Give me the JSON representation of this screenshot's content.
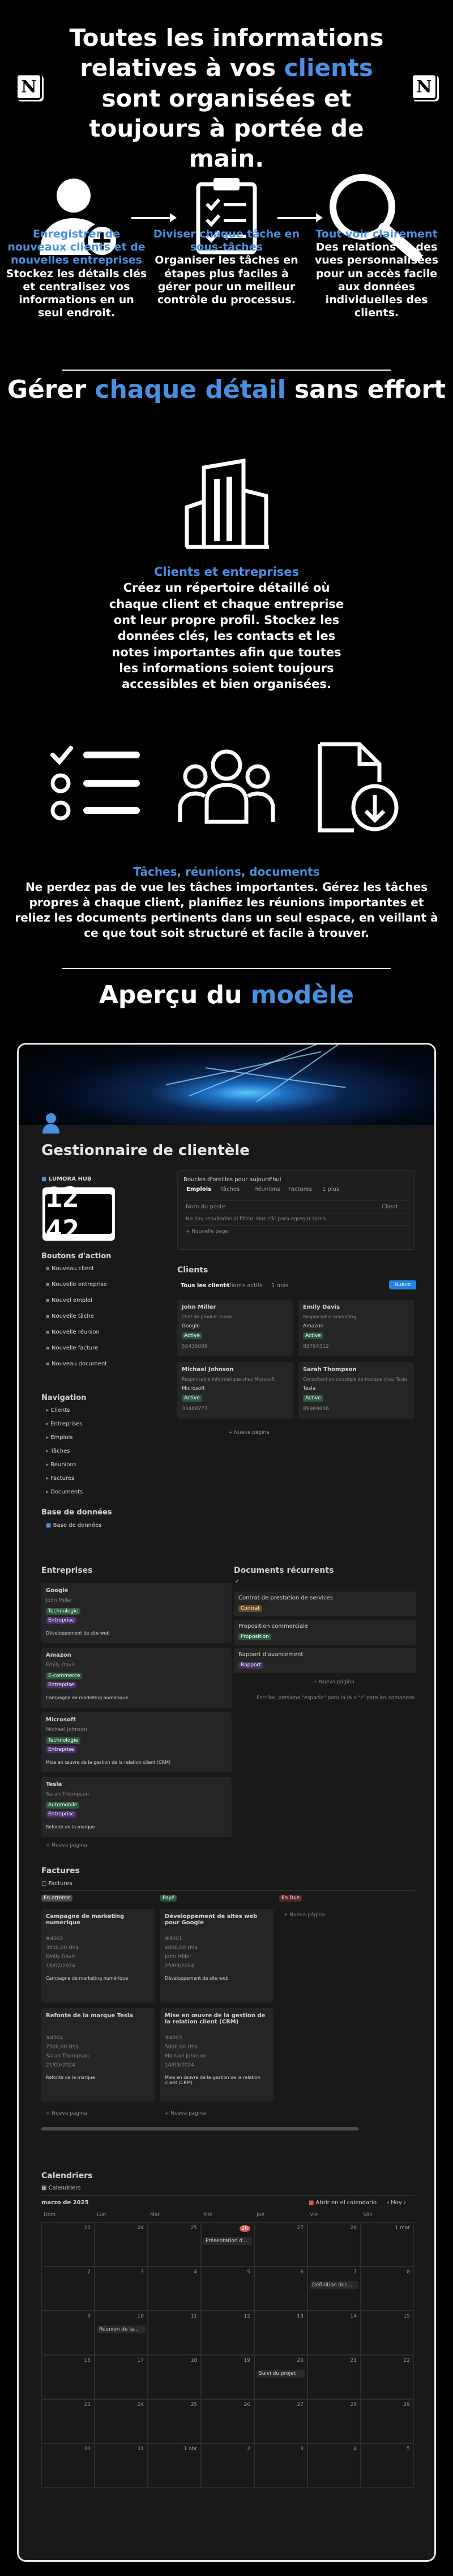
{
  "hero": {
    "title_part1": "Toutes les informations relatives à vos ",
    "title_highlight": "clients",
    "title_part2": " sont organisées et toujours à portée de main.",
    "logo_letter": "N"
  },
  "features": [
    {
      "title": "Enregistrer de nouveaux clients et de nouvelles entreprises",
      "desc": "Stockez les détails clés et centralisez vos informations en un seul endroit.",
      "icon": "add-user-icon"
    },
    {
      "title": "Diviser chaque tâche en sous-tâches",
      "desc": "Organiser les tâches en étapes plus faciles à gérer pour un meilleur contrôle du processus.",
      "icon": "checklist-icon"
    },
    {
      "title": "Tout voir clairement",
      "desc": "Des relations et des vues personnalisées pour un accès facile aux données individuelles des clients.",
      "icon": "search-icon"
    }
  ],
  "section1": {
    "prefix": "Gérer ",
    "highlight": "chaque détail",
    "suffix": " sans effort"
  },
  "clients_block": {
    "title": "Clients et entreprises",
    "desc": "Créez un répertoire détaillé où chaque client et chaque entreprise ont leur propre profil. Stockez les données clés, les contacts et les notes importantes afin que toutes les informations soient toujours accessibles et bien organisées."
  },
  "tasks_block": {
    "title": "Tâches, réunions, documents",
    "desc": "Ne perdez pas de vue les tâches importantes. Gérez les tâches propres à chaque client, planifiez les réunions importantes et reliez les documents pertinents dans un seul espace, en veillant à ce que tout soit structuré et facile à trouver."
  },
  "section2": {
    "prefix": "Aperçu du ",
    "highlight": "modèle"
  },
  "app": {
    "page_title": "Gestionnaire de clientèle",
    "hub": {
      "label": "LUMORA HUB",
      "clock": "12 42",
      "actions_title": "Boutons d'action",
      "actions": [
        "Nouveau client",
        "Nouvelle entreprise",
        "Nouvel emploi",
        "Nouvelle tâche",
        "Nouvelle réunion",
        "Nouvelle facture",
        "Nouveau document"
      ],
      "nav_title": "Navigation",
      "nav": [
        "Clients",
        "Entreprises",
        "Emplois",
        "Tâches",
        "Réunions",
        "Factures",
        "Documents"
      ],
      "db_title": "Base de données",
      "db_item": "Base de données"
    },
    "today": {
      "title": "Boucles d'oreilles pour aujourd'hui",
      "tabs": [
        "Emplois",
        "Tâches",
        "Réunions",
        "Factures",
        "1 plus"
      ],
      "cols": [
        "Nom du poste",
        "Client"
      ],
      "empty": "No hay resultados al filtrar. Haz clic para agregar tarea",
      "new": "+ Nouvelle page"
    },
    "clients": {
      "title": "Clients",
      "tabs": [
        "Tous les clients",
        "Clients actifs",
        "1 más"
      ],
      "new_button": "Nuevo",
      "cards": [
        {
          "name": "John Miller",
          "role": "Chef de produit senior",
          "company": "Google",
          "status": "Active",
          "phone": "55436098"
        },
        {
          "name": "Emily Davis",
          "role": "Responsable marketing",
          "company": "Amazon",
          "status": "Active",
          "phone": "88764312"
        },
        {
          "name": "Michael Johnson",
          "role": "Responsable informatique chez Microsoft",
          "company": "Microsoft",
          "status": "Active",
          "phone": "33468777"
        },
        {
          "name": "Sarah Thompson",
          "role": "Consultant en stratégie de marque chez Tesla",
          "company": "Tesla",
          "status": "Active",
          "phone": "89969836"
        }
      ],
      "new_page": "+ Nueva página"
    },
    "companies": {
      "title": "Entreprises",
      "cards": [
        {
          "name": "Google",
          "person": "John Miller",
          "tags": [
            "Technologie",
            "Entreprise"
          ],
          "job": "Développement de site web"
        },
        {
          "name": "Amazon",
          "person": "Emily Davis",
          "tags": [
            "E-commerce",
            "Entreprise"
          ],
          "job": "Campagne de marketing numérique"
        },
        {
          "name": "Microsoft",
          "person": "Michael Johnson",
          "tags": [
            "Technologie",
            "Entreprise"
          ],
          "job": "Mise en œuvre de la gestion de la relation client (CRM)"
        },
        {
          "name": "Tesla",
          "person": "Sarah Thompson",
          "tags": [
            "Automobile",
            "Entreprise"
          ],
          "job": "Refonte de la marque"
        }
      ],
      "new_page": "+ Nueva página"
    },
    "documents": {
      "title": "Documents récurrents",
      "items": [
        {
          "name": "Contrat de prestation de services",
          "tag": "Contrat"
        },
        {
          "name": "Proposition commerciale",
          "tag": "Proposition"
        },
        {
          "name": "Rapport d'avancement",
          "tag": "Rapport"
        }
      ],
      "new_page": "+ Nueva página",
      "footer": "Escribe, presiona \"espacio\" para la IA o \"/\" para los comandos"
    },
    "invoices": {
      "title": "Factures",
      "tab": "Factures",
      "groups": [
        {
          "status": "En attente",
          "color": "#4d4d4d",
          "cards": [
            {
              "title": "Campagne de marketing numérique",
              "id": "#4002",
              "amount": "3500,00 US$",
              "person": "Emily Davis",
              "date": "18/02/2024",
              "job": "Campagne de marketing numérique"
            },
            {
              "title": "Refonte de la marque Tesla",
              "id": "#4004",
              "amount": "7500,00 US$",
              "person": "Sarah Thompson",
              "date": "21/05/2024",
              "job": "Refonte de la marque"
            }
          ]
        },
        {
          "status": "Payé",
          "color": "#2b593f",
          "cards": [
            {
              "title": "Développement de sites web pour Google",
              "id": "#4001",
              "amount": "4800,00 US$",
              "person": "John Miller",
              "date": "25/09/2024",
              "job": "Développement de site web"
            },
            {
              "title": "Mise en œuvre de la gestion de la relation client (CRM)",
              "id": "#4003",
              "amount": "5800,00 US$",
              "person": "Michael Johnson",
              "date": "14/03/2024",
              "job": "Mise en œuvre de la gestion de la relation client (CRM)"
            }
          ]
        },
        {
          "status": "En Due",
          "color": "#5a2626",
          "cards": []
        }
      ],
      "new_page": "+ Nueva página"
    },
    "calendar": {
      "title": "Calendriers",
      "tab": "Calendriers",
      "month": "marzo de 2025",
      "open_label": "Abrir en el calendario",
      "today_label": "Hoy",
      "days": [
        "Dom",
        "Lun",
        "Mar",
        "Mié",
        "Jue",
        "Vie",
        "Sáb"
      ],
      "weeks": [
        [
          "23",
          "24",
          "25",
          "26",
          "27",
          "28",
          "1 mar"
        ],
        [
          "2",
          "3",
          "4",
          "5",
          "6",
          "7",
          "8"
        ],
        [
          "9",
          "10",
          "11",
          "12",
          "13",
          "14",
          "15"
        ],
        [
          "16",
          "17",
          "18",
          "19",
          "20",
          "21",
          "22"
        ],
        [
          "23",
          "24",
          "25",
          "26",
          "27",
          "28",
          "29"
        ],
        [
          "30",
          "31",
          "1 abr",
          "2",
          "3",
          "4",
          "5"
        ]
      ],
      "today_cell": "26",
      "events": [
        {
          "week": 0,
          "day": 3,
          "label": "Présentation d..."
        },
        {
          "week": 1,
          "day": 5,
          "label": "Définition des..."
        },
        {
          "week": 2,
          "day": 1,
          "label": "Réunion de la..."
        },
        {
          "week": 3,
          "day": 4,
          "label": "Suivi du projet"
        }
      ]
    }
  },
  "colors": {
    "accent": "#4a90e2",
    "background": "#000000",
    "app_bg": "#191919"
  }
}
